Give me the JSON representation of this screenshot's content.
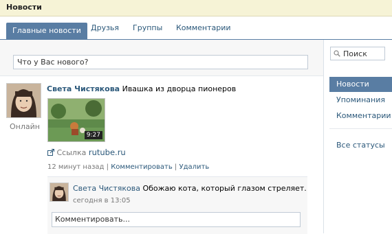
{
  "header": {
    "title": "Новости"
  },
  "tabs": [
    {
      "label": "Главные новости"
    },
    {
      "label": "Друзья"
    },
    {
      "label": "Группы"
    },
    {
      "label": "Комментарии"
    }
  ],
  "status": {
    "placeholder": "Что у Вас нового?"
  },
  "post": {
    "author": "Света Чистякова",
    "text": "Ивашка из дворца пионеров",
    "online": "Онлайн",
    "video_duration": "9:27",
    "link_prefix": "Ссылка",
    "link_url": "rutube.ru",
    "time": "12 минут назад",
    "separator": "|",
    "comment_action": "Комментировать",
    "delete_action": "Удалить"
  },
  "comment": {
    "author": "Света Чистякова",
    "text": "Обожаю кота, который глазом стреляет.",
    "time": "сегодня в 13:05",
    "input_placeholder": "Комментировать..."
  },
  "sidebar": {
    "search_placeholder": "Поиск",
    "items": [
      {
        "label": "Новости"
      },
      {
        "label": "Упоминания"
      },
      {
        "label": "Комментарии"
      },
      {
        "label": "Все статусы"
      }
    ]
  },
  "colors": {
    "accent": "#597da3",
    "link": "#2b587a",
    "header_bg": "#f6f3d6"
  },
  "icons": {
    "search": "search-icon",
    "link": "external-link-icon",
    "avatar": "avatar"
  }
}
